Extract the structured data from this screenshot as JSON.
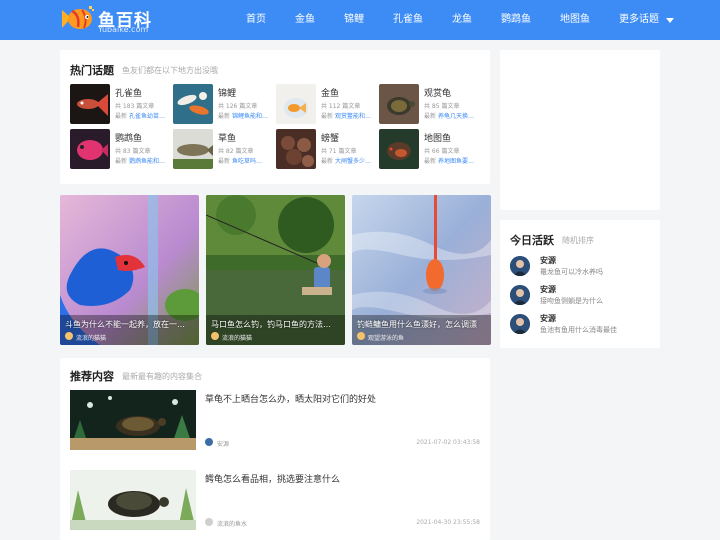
{
  "site": {
    "title": "鱼百科",
    "subtitle": "Yubaike.com"
  },
  "nav": [
    {
      "label": "首页"
    },
    {
      "label": "金鱼"
    },
    {
      "label": "锦鲤"
    },
    {
      "label": "孔雀鱼"
    },
    {
      "label": "龙鱼"
    },
    {
      "label": "鹦鹉鱼"
    },
    {
      "label": "地图鱼"
    }
  ],
  "nav_more": "更多话题",
  "hot": {
    "title": "热门话题",
    "subtitle": "鱼友们都在以下地方出没哦",
    "latest_label": "最新",
    "topics": [
      {
        "name": "孔雀鱼",
        "count": "共 183 篇文章",
        "latest": "孔雀鱼幼苗…"
      },
      {
        "name": "锦鲤",
        "count": "共 126 篇文章",
        "latest": "锦鲤鱼能和…"
      },
      {
        "name": "金鱼",
        "count": "共 112 篇文章",
        "latest": "观赏鳖能和…"
      },
      {
        "name": "观赏龟",
        "count": "共 85 篇文章",
        "latest": "养龟几天换…"
      },
      {
        "name": "鹦鹉鱼",
        "count": "共 83 篇文章",
        "latest": "鹦鹉鱼能和…"
      },
      {
        "name": "草鱼",
        "count": "共 82 篇文章",
        "latest": "鱼吃草吗…"
      },
      {
        "name": "螃蟹",
        "count": "共 71 篇文章",
        "latest": "大闸蟹多少…"
      },
      {
        "name": "地图鱼",
        "count": "共 66 篇文章",
        "latest": "养地图鱼要…"
      }
    ]
  },
  "features": [
    {
      "title": "斗鱼为什么不能一起养，放在一…",
      "author": "流浪的猫猫"
    },
    {
      "title": "马口鱼怎么钓，钓马口鱼的方法…",
      "author": "流浪的猫猫"
    },
    {
      "title": "钓鲢鳙鱼用什么鱼漂好，怎么调漂",
      "author": "观望游泳的鱼"
    }
  ],
  "active": {
    "title": "今日活跃",
    "subtitle": "随机排序",
    "items": [
      {
        "name": "安源",
        "text": "鼍龙鱼可以冷水养吗"
      },
      {
        "name": "安源",
        "text": "接吻鱼侧躺是为什么"
      },
      {
        "name": "安源",
        "text": "鱼池有鱼用什么消毒最佳"
      }
    ]
  },
  "recommend": {
    "title": "推荐内容",
    "subtitle": "最新最有趣的内容集合",
    "items": [
      {
        "title": "草龟不上晒台怎么办，晒太阳对它们的好处",
        "author": "安源",
        "time": "2021-07-02 03:43:58"
      },
      {
        "title": "鳄龟怎么看品相，挑选要注意什么",
        "author": "流浪的鱼水",
        "time": "2021-04-30 23:55:58"
      }
    ]
  },
  "colors": {
    "brand": "#3d8cf5",
    "link": "#3d8cf5"
  }
}
